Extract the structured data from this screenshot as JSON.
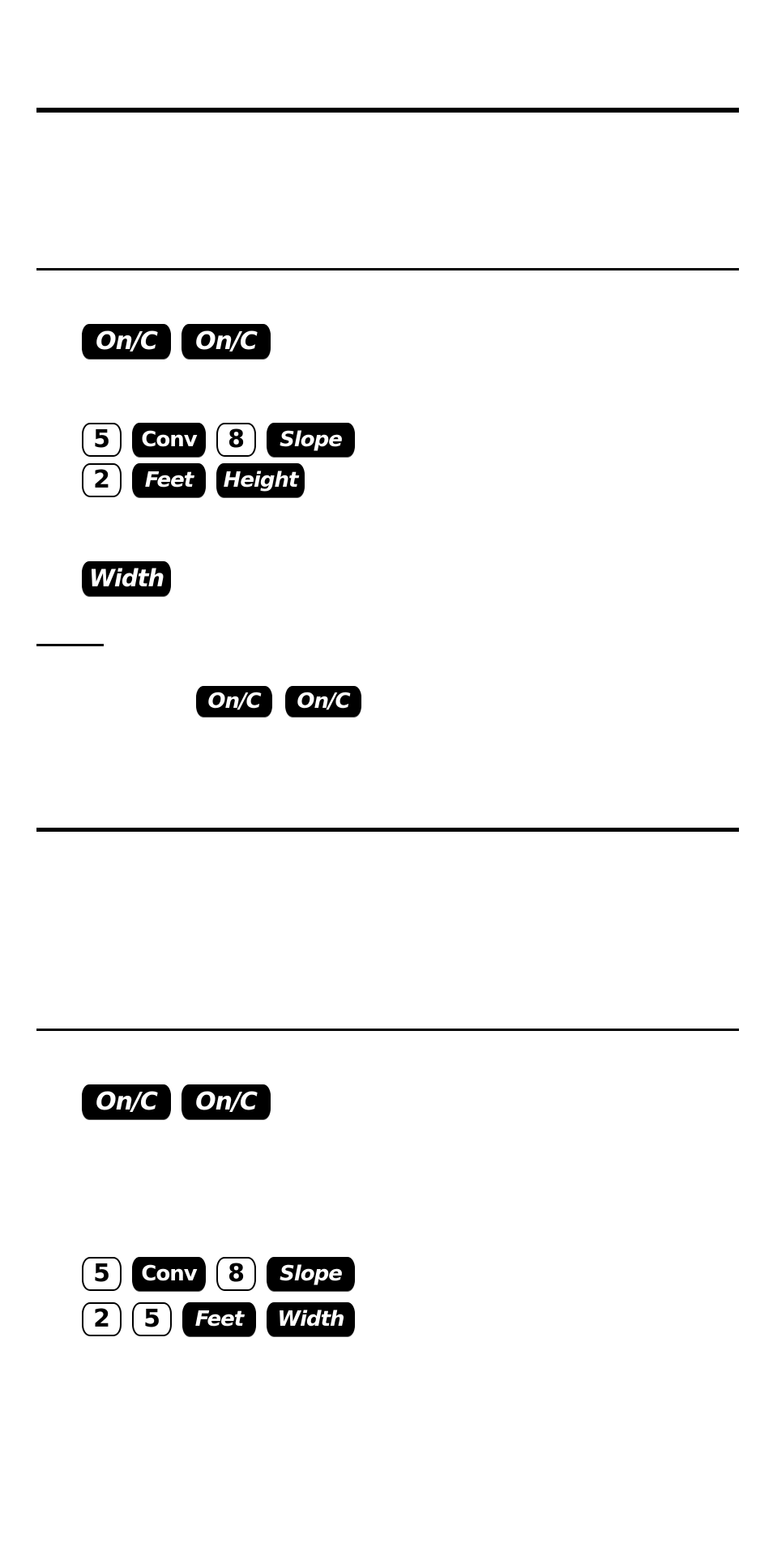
{
  "document": {
    "type": "calculator-manual-page",
    "colors": {
      "background": "#ffffff",
      "ink": "#000000",
      "key_text_on_dark": "#ffffff"
    }
  },
  "section1": {
    "step_clear": {
      "keys": [
        {
          "label": "On/C",
          "kind": "function"
        },
        {
          "label": "On/C",
          "kind": "function"
        }
      ]
    },
    "step_enter_slope": {
      "keys": [
        {
          "label": "5",
          "kind": "number"
        },
        {
          "label": "Conv",
          "kind": "function"
        },
        {
          "label": "8",
          "kind": "number"
        },
        {
          "label": "Slope",
          "kind": "function"
        }
      ]
    },
    "step_enter_height": {
      "keys": [
        {
          "label": "2",
          "kind": "number"
        },
        {
          "label": "Feet",
          "kind": "function"
        },
        {
          "label": "Height",
          "kind": "function"
        }
      ]
    },
    "step_solve": {
      "keys": [
        {
          "label": "Width",
          "kind": "function"
        }
      ]
    },
    "note_clear": {
      "keys": [
        {
          "label": "On/C",
          "kind": "function"
        },
        {
          "label": "On/C",
          "kind": "function"
        }
      ]
    }
  },
  "section2": {
    "step_clear": {
      "keys": [
        {
          "label": "On/C",
          "kind": "function"
        },
        {
          "label": "On/C",
          "kind": "function"
        }
      ]
    },
    "step_enter_slope": {
      "keys": [
        {
          "label": "5",
          "kind": "number"
        },
        {
          "label": "Conv",
          "kind": "function"
        },
        {
          "label": "8",
          "kind": "number"
        },
        {
          "label": "Slope",
          "kind": "function"
        }
      ]
    },
    "step_enter_width": {
      "keys": [
        {
          "label": "2",
          "kind": "number"
        },
        {
          "label": "5",
          "kind": "number"
        },
        {
          "label": "Feet",
          "kind": "function"
        },
        {
          "label": "Width",
          "kind": "function"
        }
      ]
    }
  }
}
